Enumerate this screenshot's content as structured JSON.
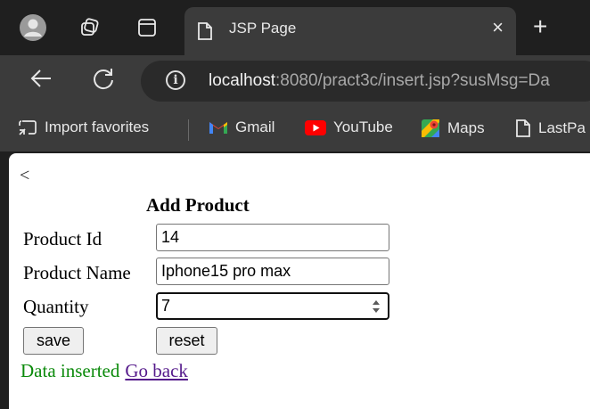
{
  "browser": {
    "tab_title": "JSP Page",
    "tab_close": "×",
    "new_tab": "+",
    "url_host": "localhost",
    "url_rest": ":8080/pract3c/insert.jsp?susMsg=Da",
    "favorites": [
      {
        "label": "Import favorites",
        "icon": "import-icon"
      },
      {
        "label": "Gmail",
        "icon": "gmail-icon"
      },
      {
        "label": "YouTube",
        "icon": "youtube-icon"
      },
      {
        "label": "Maps",
        "icon": "maps-icon"
      },
      {
        "label": "LastPa",
        "icon": "page-icon"
      }
    ]
  },
  "page": {
    "back_symbol": "<",
    "heading": "Add Product",
    "fields": [
      {
        "label": "Product Id",
        "value": "14"
      },
      {
        "label": "Product Name",
        "value": "Iphone15 pro max"
      },
      {
        "label": "Quantity",
        "value": "7"
      }
    ],
    "save_label": "save",
    "reset_label": "reset",
    "message": "Data inserted",
    "go_back_label": "Go back"
  },
  "colors": {
    "success": "#0b8a0b",
    "visited_link": "#551a8b",
    "chrome_dark": "#1f1f1f",
    "chrome_mid": "#3b3b3b"
  }
}
